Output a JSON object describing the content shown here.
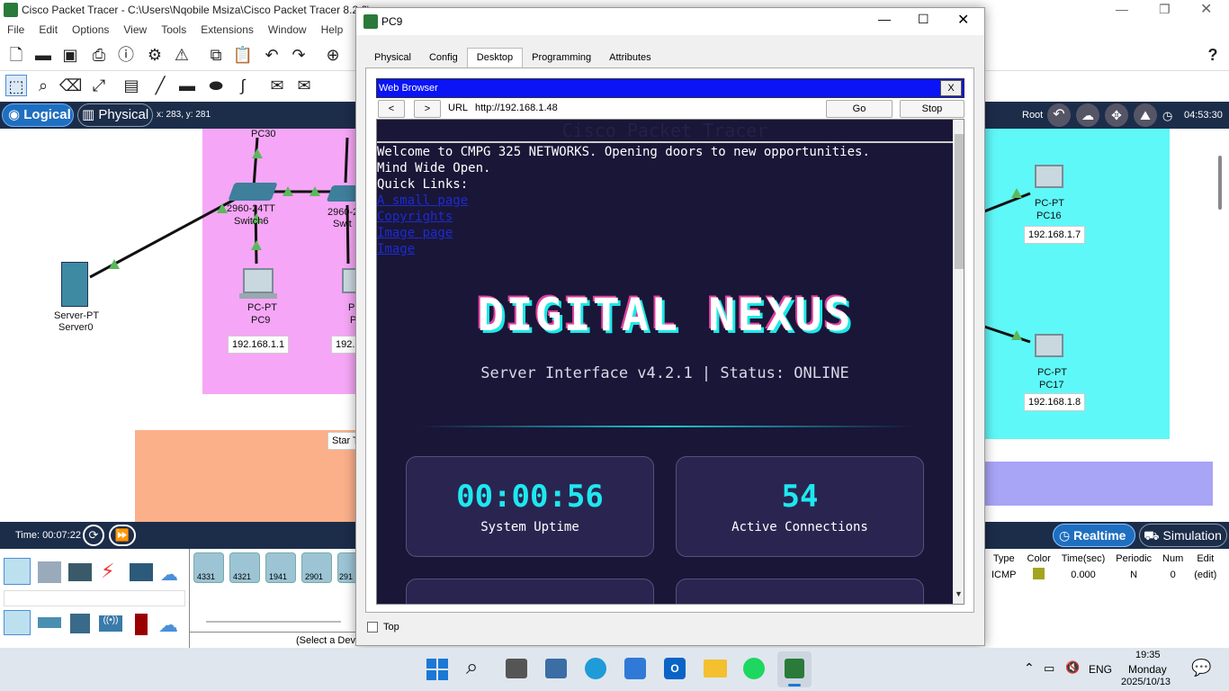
{
  "app": {
    "title": "Cisco Packet Tracer - C:\\Users\\Nqobile Msiza\\Cisco Packet Tracer 8.2.2\\",
    "title_tail": "...",
    "menu": [
      "File",
      "Edit",
      "Options",
      "View",
      "Tools",
      "Extensions",
      "Window",
      "Help"
    ],
    "help_icon": "?"
  },
  "navbar": {
    "logical_label": "Logical",
    "physical_label": "Physical",
    "coords": "x: 283, y: 281",
    "root_label": "Root",
    "clock": "04:53:30"
  },
  "canvas": {
    "devices": [
      {
        "id": "pc30",
        "model": "",
        "name": "PC30"
      },
      {
        "id": "switch6",
        "model": "2960-24TT",
        "name": "Switch6"
      },
      {
        "id": "switch_b",
        "model": "2960-2",
        "name": "Swit"
      },
      {
        "id": "server0",
        "model": "Server-PT",
        "name": "Server0"
      },
      {
        "id": "pc9",
        "model": "PC-PT",
        "name": "PC9",
        "ip": "192.168.1.1"
      },
      {
        "id": "pc_b",
        "model": "PC",
        "name": "P",
        "ip": "192.1"
      },
      {
        "id": "pc16",
        "model": "PC-PT",
        "name": "PC16",
        "ip": "192.168.1.7"
      },
      {
        "id": "pc17",
        "model": "PC-PT",
        "name": "PC17",
        "ip": "192.168.1.8"
      }
    ],
    "star_label": "Star T"
  },
  "statusbar": {
    "time": "Time: 00:07:22",
    "realtime": "Realtime",
    "simulation": "Simulation"
  },
  "device_panel": {
    "routers": [
      "4331",
      "4321",
      "1941",
      "2901",
      "291"
    ],
    "select_hint": "(Select a Dev"
  },
  "pdu_table": {
    "headers": [
      "Type",
      "Color",
      "Time(sec)",
      "Periodic",
      "Num",
      "Edit"
    ],
    "row": {
      "type": "ICMP",
      "color": "#a3a51e",
      "time": "0.000",
      "periodic": "N",
      "num": "0",
      "edit": "(edit)"
    }
  },
  "dialog": {
    "title": "PC9",
    "tabs": [
      "Physical",
      "Config",
      "Desktop",
      "Programming",
      "Attributes"
    ],
    "selected_tab": "Desktop",
    "browser": {
      "title": "Web Browser",
      "close": "X",
      "back": "<",
      "forward": ">",
      "url_label": "URL",
      "url": "http://192.168.1.48",
      "go": "Go",
      "stop": "Stop"
    },
    "page": {
      "header": "Cisco Packet Tracer",
      "welcome": "Welcome to CMPG 325 NETWORKS. Opening doors to new opportunities.",
      "tagline": "Mind Wide Open.",
      "links_title": "Quick Links:",
      "links": [
        "A small page",
        "Copyrights",
        "Image page",
        "Image"
      ],
      "hero": "DIGITAL NEXUS",
      "subtitle": "Server Interface v4.2.1 | Status: ONLINE",
      "cards": [
        {
          "value": "00:00:56",
          "label": "System Uptime"
        },
        {
          "value": "54",
          "label": "Active Connections"
        }
      ]
    },
    "top_checkbox": "Top"
  },
  "taskbar": {
    "lang": "ENG",
    "time": "19:35",
    "day": "Monday",
    "date": "2025/10/13"
  }
}
